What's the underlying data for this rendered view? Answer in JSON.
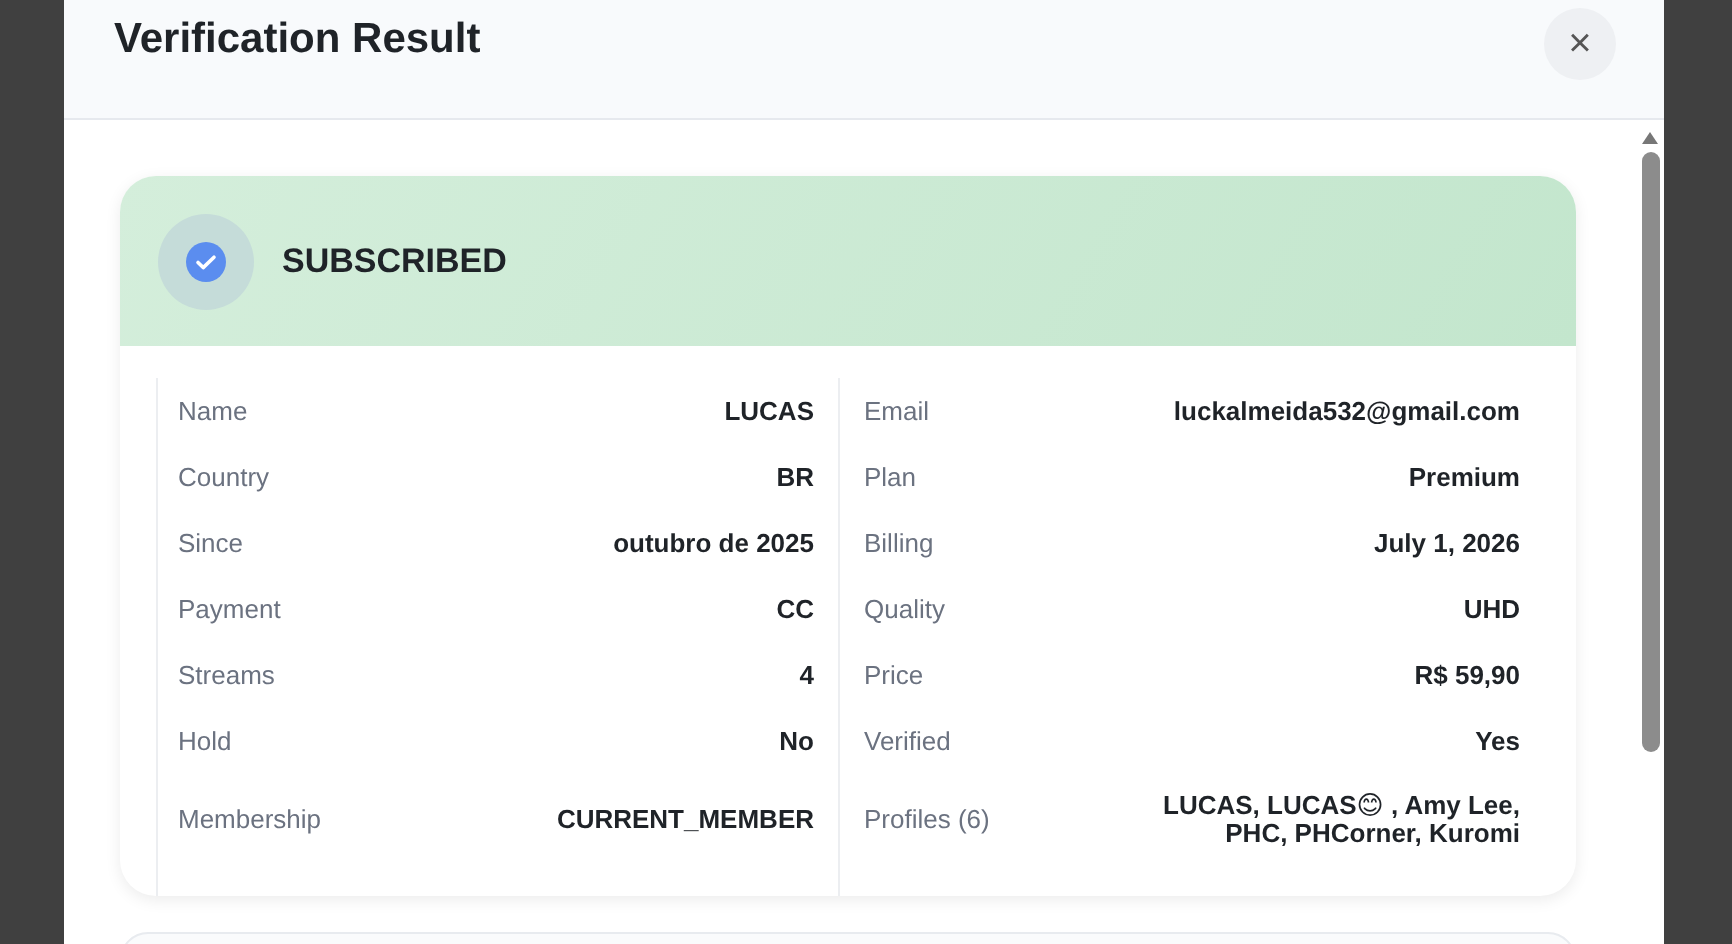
{
  "dialog": {
    "title": "Verification Result",
    "close_label": "×"
  },
  "status": {
    "label": "SUBSCRIBED",
    "verified": true
  },
  "left_fields": [
    {
      "label": "Name",
      "value": "LUCAS"
    },
    {
      "label": "Country",
      "value": "BR"
    },
    {
      "label": "Since",
      "value": "outubro de 2025"
    },
    {
      "label": "Payment",
      "value": "CC"
    },
    {
      "label": "Streams",
      "value": "4"
    },
    {
      "label": "Hold",
      "value": "No"
    },
    {
      "label": "Membership",
      "value": "CURRENT_MEMBER"
    }
  ],
  "right_fields": [
    {
      "label": "Email",
      "value": "luckalmeida532@gmail.com"
    },
    {
      "label": "Plan",
      "value": "Premium"
    },
    {
      "label": "Billing",
      "value": "July 1, 2026"
    },
    {
      "label": "Quality",
      "value": "UHD"
    },
    {
      "label": "Price",
      "value": "R$ 59,90"
    },
    {
      "label": "Verified",
      "value": "Yes"
    },
    {
      "label": "Profiles (6)",
      "value": "LUCAS, LUCAS😊 , Amy Lee, PHC, PHCorner, Kuromi"
    }
  ]
}
